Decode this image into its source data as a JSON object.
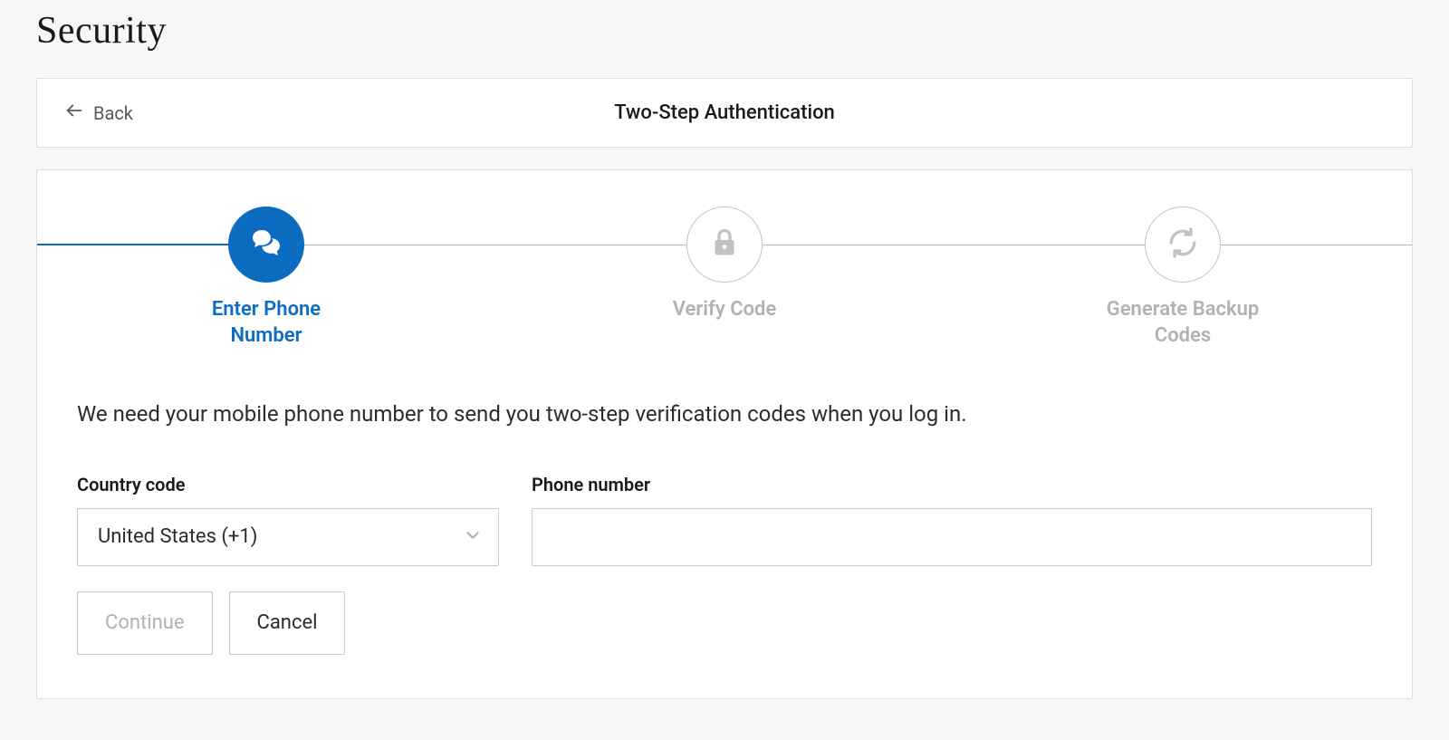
{
  "page": {
    "title": "Security"
  },
  "header": {
    "back_label": "Back",
    "title": "Two-Step Authentication"
  },
  "stepper": {
    "steps": [
      {
        "label": "Enter Phone Number",
        "active": true
      },
      {
        "label": "Verify Code",
        "active": false
      },
      {
        "label": "Generate Backup Codes",
        "active": false
      }
    ]
  },
  "form": {
    "instruction": "We need your mobile phone number to send you two-step verification codes when you log in.",
    "country_label": "Country code",
    "country_value": "United States (+1)",
    "phone_label": "Phone number",
    "phone_value": ""
  },
  "buttons": {
    "continue_label": "Continue",
    "cancel_label": "Cancel"
  }
}
